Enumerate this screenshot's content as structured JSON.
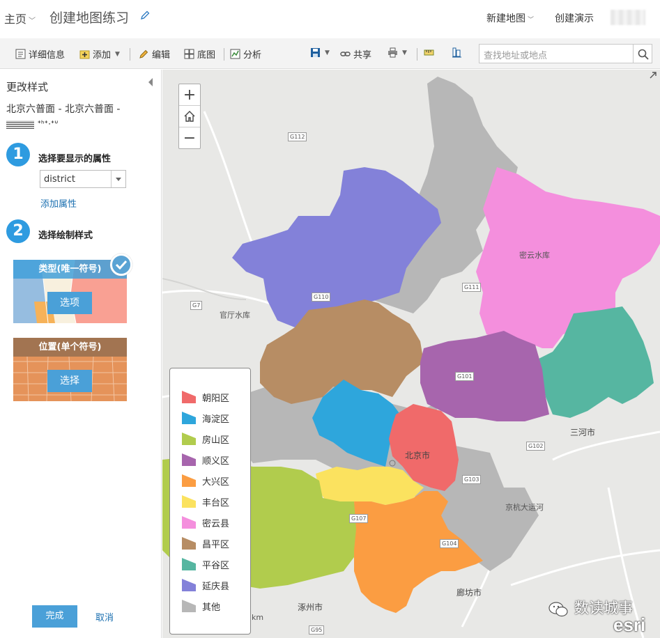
{
  "header": {
    "home_label": "主页",
    "map_title": "创建地图练习",
    "new_map_label": "新建地图",
    "create_presentation_label": "创建演示"
  },
  "toolbar": {
    "details_label": "详细信息",
    "add_label": "添加",
    "edit_label": "编辑",
    "basemap_label": "底图",
    "analysis_label": "分析",
    "share_label": "共享",
    "search_placeholder": "查找地址或地点"
  },
  "panel": {
    "title": "更改样式",
    "layer_name": "北京六普面 - 北京六普面 -",
    "layer_name_suffix": "ᐩᑋᐩᐧᐩᐡ",
    "step1": {
      "num": "1",
      "label": "选择要显示的属性"
    },
    "attribute_value": "district",
    "add_attribute_label": "添加属性",
    "step2": {
      "num": "2",
      "label": "选择绘制样式"
    },
    "style_types": [
      {
        "title": "类型(唯一符号)",
        "button": "选项",
        "selected": true
      },
      {
        "title": "位置(单个符号)",
        "button": "选择",
        "selected": false
      }
    ],
    "done_label": "完成",
    "cancel_label": "取消"
  },
  "map": {
    "zoom_in": "+",
    "zoom_out": "−",
    "places": {
      "guanting": "官厅水库",
      "miyun": "密云水库",
      "beijing": "北京市",
      "sanhe": "三河市",
      "langfang": "廊坊市",
      "zhuozhou": "涿州市",
      "jinghang": "京杭大运河",
      "km": "km"
    },
    "roads": {
      "g112": "G112",
      "g7": "G7",
      "g111": "G111",
      "g110": "G110",
      "g101": "G101",
      "g102": "G102",
      "g103": "G103",
      "g104": "G104",
      "g107": "G107",
      "g95": "G95"
    },
    "legend": [
      {
        "label": "朝阳区",
        "color": "#f06a6a"
      },
      {
        "label": "海淀区",
        "color": "#2ea6dc"
      },
      {
        "label": "房山区",
        "color": "#b1cc4d"
      },
      {
        "label": "顺义区",
        "color": "#a765ad"
      },
      {
        "label": "大兴区",
        "color": "#fb9d42"
      },
      {
        "label": "丰台区",
        "color": "#fbe25f"
      },
      {
        "label": "密云县",
        "color": "#f48fdd"
      },
      {
        "label": "昌平区",
        "color": "#b78d64"
      },
      {
        "label": "平谷区",
        "color": "#56b6a1"
      },
      {
        "label": "延庆县",
        "color": "#8381d9"
      },
      {
        "label": "其他",
        "color": "#b7b7b7"
      }
    ]
  },
  "watermark": {
    "text": "数读城事",
    "brand": "esri"
  }
}
